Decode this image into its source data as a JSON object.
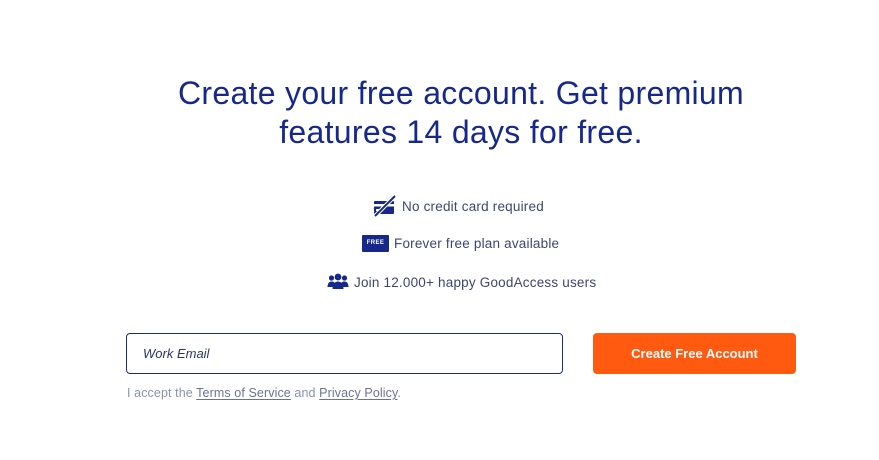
{
  "headline": {
    "line1": "Create your free account. Get premium",
    "line2": "features 14 days for free."
  },
  "features": [
    {
      "icon": "no-credit-card-icon",
      "text": "No credit card required"
    },
    {
      "icon": "free-badge-icon",
      "badge": "FREE",
      "text": "Forever free plan available"
    },
    {
      "icon": "users-group-icon",
      "text": "Join 12.000+ happy GoodAccess users"
    }
  ],
  "form": {
    "email_placeholder": "Work Email",
    "email_value": "",
    "submit_label": "Create Free Account"
  },
  "consent": {
    "prefix": "I accept the ",
    "terms_link": "Terms of Service",
    "middle": " and ",
    "privacy_link": "Privacy Policy",
    "suffix": "."
  },
  "colors": {
    "heading": "#17288c",
    "accent": "#ff5a0f",
    "text": "#3c4670",
    "muted": "#8a92b0"
  }
}
